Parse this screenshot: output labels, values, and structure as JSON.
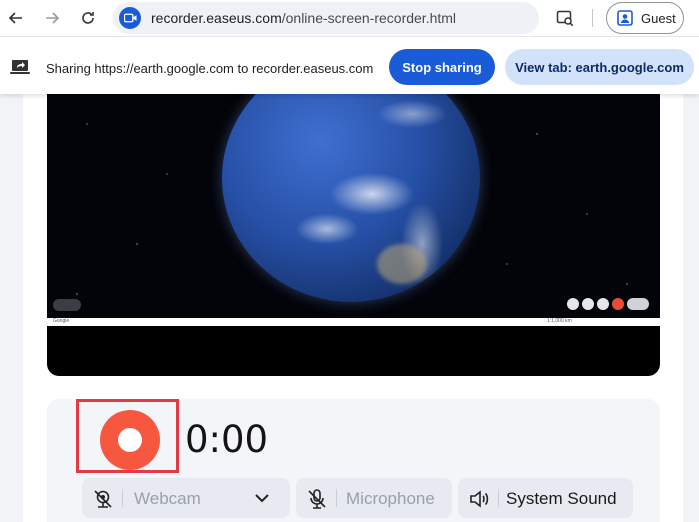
{
  "browser": {
    "url_host": "recorder.easeus.com",
    "url_path": "/online-screen-recorder.html",
    "profile_label": "Guest",
    "icons": [
      "back-arrow-icon",
      "forward-arrow-icon",
      "reload-icon",
      "video-site-icon",
      "page-search-icon",
      "person-icon"
    ]
  },
  "sharebar": {
    "message": "Sharing https://earth.google.com to recorder.easeus.com",
    "stop_label": "Stop sharing",
    "view_label": "View tab: earth.google.com"
  },
  "preview": {
    "status_left": "Google",
    "status_right": "1:1,000 km"
  },
  "recorder": {
    "timer": "0:00",
    "webcam_label": "Webcam",
    "microphone_label": "Microphone",
    "system_sound_label": "System Sound",
    "record_color": "#f5573f",
    "highlight_color": "#e23a47"
  },
  "colors": {
    "primary": "#1a5cd8",
    "secondary_bg": "#d3e2fb"
  }
}
